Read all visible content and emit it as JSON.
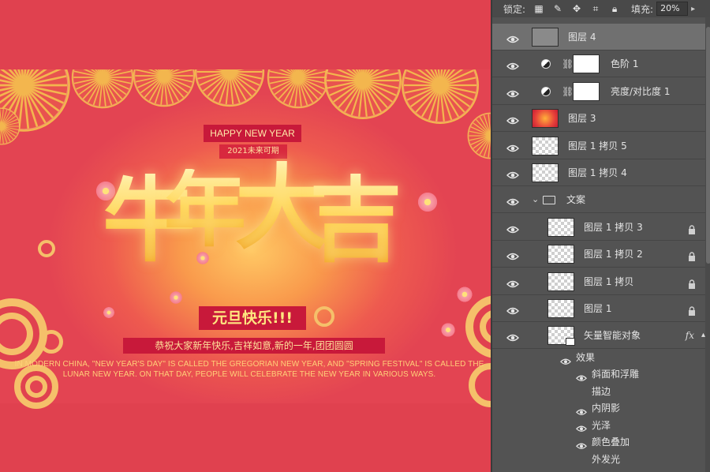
{
  "canvas": {
    "hny_banner": "HAPPY NEW YEAR",
    "tagline": "2021未来可期",
    "title_chars": [
      "牛",
      "年",
      "大",
      "吉"
    ],
    "subtitle": "元旦快乐!!!",
    "wish": "恭祝大家新年快乐,吉祥如意,新的一年,团团圆圆",
    "english": "IN MODERN CHINA, \"NEW YEAR'S DAY\" IS CALLED THE GREGORIAN NEW YEAR, AND \"SPRING FESTIVAL\" IS CALLED THE LUNAR NEW YEAR. ON THAT DAY, PEOPLE WILL CELEBRATE THE NEW YEAR IN VARIOUS WAYS.",
    "colors": {
      "background": "#e0414f",
      "gold": "#ffd24a",
      "ribbon": "#c8193a"
    }
  },
  "panel": {
    "lock_label": "锁定:",
    "lock_icons": [
      "checker-icon",
      "brush-icon",
      "move-icon",
      "crop-icon",
      "lock-icon"
    ],
    "fill_label": "填充:",
    "fill_value": "20%",
    "layers": [
      {
        "name": "图层 4",
        "thumb": "gray",
        "selected": true
      },
      {
        "name": "色阶 1",
        "thumb": "adjust-levels"
      },
      {
        "name": "亮度/对比度 1",
        "thumb": "adjust-brightness"
      },
      {
        "name": "图层 3",
        "thumb": "image"
      },
      {
        "name": "图层 1 拷贝 5",
        "thumb": "transparent"
      },
      {
        "name": "图层 1 拷贝 4",
        "thumb": "transparent"
      },
      {
        "name": "文案",
        "thumb": "folder"
      },
      {
        "name": "图层 1 拷贝 3",
        "thumb": "transparent",
        "locked": true,
        "indent": true
      },
      {
        "name": "图层 1 拷贝 2",
        "thumb": "transparent",
        "locked": true,
        "indent": true
      },
      {
        "name": "图层 1 拷贝",
        "thumb": "transparent",
        "locked": true,
        "indent": true
      },
      {
        "name": "图层 1",
        "thumb": "transparent",
        "locked": true,
        "indent": true
      },
      {
        "name": "矢量智能对象",
        "thumb": "smart-object",
        "fx": "fx",
        "indent": true
      }
    ],
    "effects_label": "效果",
    "effects": [
      {
        "name": "斜面和浮雕",
        "visible": true
      },
      {
        "name": "描边",
        "visible": false
      },
      {
        "name": "内阴影",
        "visible": true
      },
      {
        "name": "光泽",
        "visible": true
      },
      {
        "name": "颜色叠加",
        "visible": true
      },
      {
        "name": "外发光",
        "visible": false
      }
    ]
  }
}
